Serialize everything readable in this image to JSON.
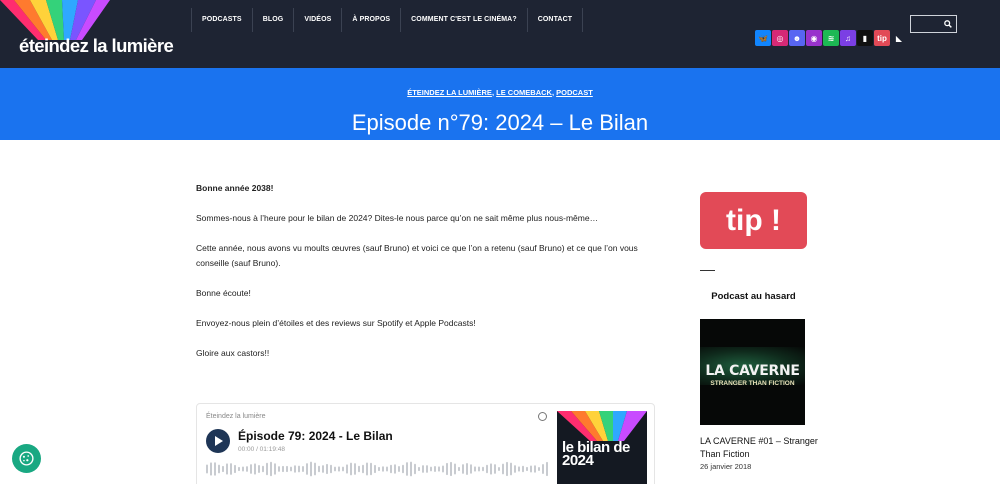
{
  "header": {
    "logo_text": "éteindez la lumière",
    "nav": [
      "PODCASTS",
      "BLOG",
      "VIDÉOS",
      "À PROPOS",
      "COMMENT C'EST LE CINÉMA?",
      "CONTACT"
    ],
    "social": [
      {
        "name": "bluesky-icon",
        "color": "#1185fe",
        "glyph": "🦋"
      },
      {
        "name": "instagram-icon",
        "color": "#d62976",
        "glyph": "◎"
      },
      {
        "name": "discord-icon",
        "color": "#5865f2",
        "glyph": "☻"
      },
      {
        "name": "apple-podcasts-icon",
        "color": "#9933cc",
        "glyph": "◉"
      },
      {
        "name": "spotify-icon",
        "color": "#1db954",
        "glyph": "≋"
      },
      {
        "name": "podcast-addict-icon",
        "color": "#7b3fe4",
        "glyph": "♫"
      },
      {
        "name": "deezer-icon",
        "color": "#111111",
        "glyph": "▮"
      },
      {
        "name": "tipeee-icon",
        "color": "#e24a57",
        "glyph": "tip"
      },
      {
        "name": "rss-icon",
        "color": "#1e2433",
        "glyph": "◣"
      }
    ]
  },
  "banner": {
    "categories": [
      "ÉTEINDEZ LA LUMIÈRE",
      "LE COMEBACK",
      "PODCAST"
    ],
    "title": "Episode n°79: 2024 – Le Bilan"
  },
  "article": {
    "paragraphs": [
      "Bonne année 2038!",
      "Sommes-nous à l’heure pour le bilan de 2024? Dites-le nous parce qu’on ne sait même plus nous-même…",
      "Cette année, nous avons vu moults œuvres (sauf Bruno) et voici ce que l’on a retenu (sauf Bruno) et ce que l’on vous conseille (sauf Bruno).",
      "Bonne écoute!",
      "Envoyez-nous plein d’étoiles et des reviews sur Spotify et Apple Podcasts!",
      "Gloire aux castors!!"
    ]
  },
  "player": {
    "show": "Éteindez la lumière",
    "title": "Épisode 79: 2024 - Le Bilan",
    "time": "00:00 / 01:19:48",
    "cover_text": "le bilan de 2024"
  },
  "sidebar": {
    "tip_label": "tip !",
    "heading": "Podcast au hasard",
    "thumb_title": "LA CAVERNE",
    "thumb_subtitle": "STRANGER THAN FICTION",
    "post_title": "LA CAVERNE #01 – Stranger Than Fiction",
    "post_date": "26 janvier 2018"
  }
}
